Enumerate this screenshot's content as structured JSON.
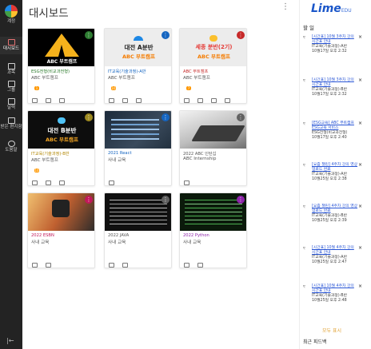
{
  "rail": {
    "items": [
      {
        "label": "계정",
        "icon": "account-icon"
      },
      {
        "label": "대시보드",
        "icon": "dashboard-icon"
      },
      {
        "label": "과목",
        "icon": "book-icon"
      },
      {
        "label": "그룹",
        "icon": "group-icon"
      },
      {
        "label": "달력",
        "icon": "calendar-icon"
      },
      {
        "label": "받은 편지함",
        "icon": "inbox-icon"
      },
      {
        "label": "도움말",
        "icon": "help-icon"
      }
    ],
    "collapse": "|←"
  },
  "header": {
    "title": "대시보드"
  },
  "cards": [
    {
      "thumb_text_1": "ABC 부트캠프",
      "thumb_text_2": "",
      "title": "ESG전형(비교과전형)",
      "sub": "ABC 부트캠프",
      "title_color": "#2b7a2b",
      "badge": "1"
    },
    {
      "thumb_text_1": "대전 A분반",
      "thumb_text_2": "ABC 부트캠프",
      "title": "IT교육(기술과정)-A반",
      "sub": "ABC 부트캠프",
      "title_color": "#1565c0",
      "badge": "10"
    },
    {
      "thumb_text_1": "세종 분반(2기)",
      "thumb_text_2": "ABC 부트캠프",
      "title": "ABC 부트캠프",
      "sub": "ABC 부트캠프",
      "title_color": "#c62828",
      "badge": "7"
    },
    {
      "thumb_text_1": "대전 B분반",
      "thumb_text_2": "ABC 부트캠프",
      "title": "IT교육(기술과정)-B반",
      "sub": "ABC 부트캠프",
      "title_color": "#b28704",
      "badge": "10"
    },
    {
      "thumb_text_1": "",
      "thumb_text_2": "",
      "title": "2021 React",
      "sub": "사내 교육",
      "title_color": "#1565c0",
      "badge": ""
    },
    {
      "thumb_text_1": "",
      "thumb_text_2": "",
      "title": "2022 ABC 인턴십",
      "sub": "ABC Internship",
      "title_color": "#555555",
      "badge": ""
    },
    {
      "thumb_text_1": "",
      "thumb_text_2": "",
      "title": "2022 ESBN",
      "sub": "사내 교육",
      "title_color": "#c2185b",
      "badge": ""
    },
    {
      "thumb_text_1": "",
      "thumb_text_2": "",
      "title": "2022 JAVA",
      "sub": "사내 교육",
      "title_color": "#555555",
      "badge": ""
    },
    {
      "thumb_text_1": "",
      "thumb_text_2": "",
      "title": "2022 Python",
      "sub": "사내 교육",
      "title_color": "#8e24aa",
      "badge": ""
    }
  ],
  "panel": {
    "logo": "Lime",
    "logo_suffix": "EDU",
    "title": "할 일",
    "notices": [
      {
        "link": "[시간표] 10월 3주차 강의 시간표 안내",
        "course": "IT교육(기술과정)-A반",
        "date": "10월17일 오후 2:32"
      },
      {
        "link": "[시간표] 10월 3주차 강의 시간표 안내",
        "course": "IT교육(기술과정)-B반",
        "date": "10월17일 오후 2:32"
      },
      {
        "link": "[ESG교육] ABC 부트캠프 ESG교육 서비스",
        "course": "ESG전형(비교과전형)",
        "date": "10월17일 오후 2:40"
      },
      {
        "link": "[요즘 챌린] 4주차 강의 영상 업로드 완료",
        "course": "IT교육(기술과정)-A반",
        "date": "10월25일 오후 2:38"
      },
      {
        "link": "[요즘 챌린] 4주차 강의 영상 업로드 완료",
        "course": "IT교육(기술과정)-B반",
        "date": "10월25일 오후 2:39"
      },
      {
        "link": "[시간표] 10월 4주차 강의 시간표 안내",
        "course": "IT교육(기술과정)-A반",
        "date": "10월25일 오후 2:47"
      },
      {
        "link": "[시간표] 10월 4주차 강의 시간표 안내",
        "course": "IT교육(기술과정)-B반",
        "date": "10월25일 오후 2:48"
      }
    ],
    "more": "모두 표시",
    "recent": "최근 피드백"
  }
}
